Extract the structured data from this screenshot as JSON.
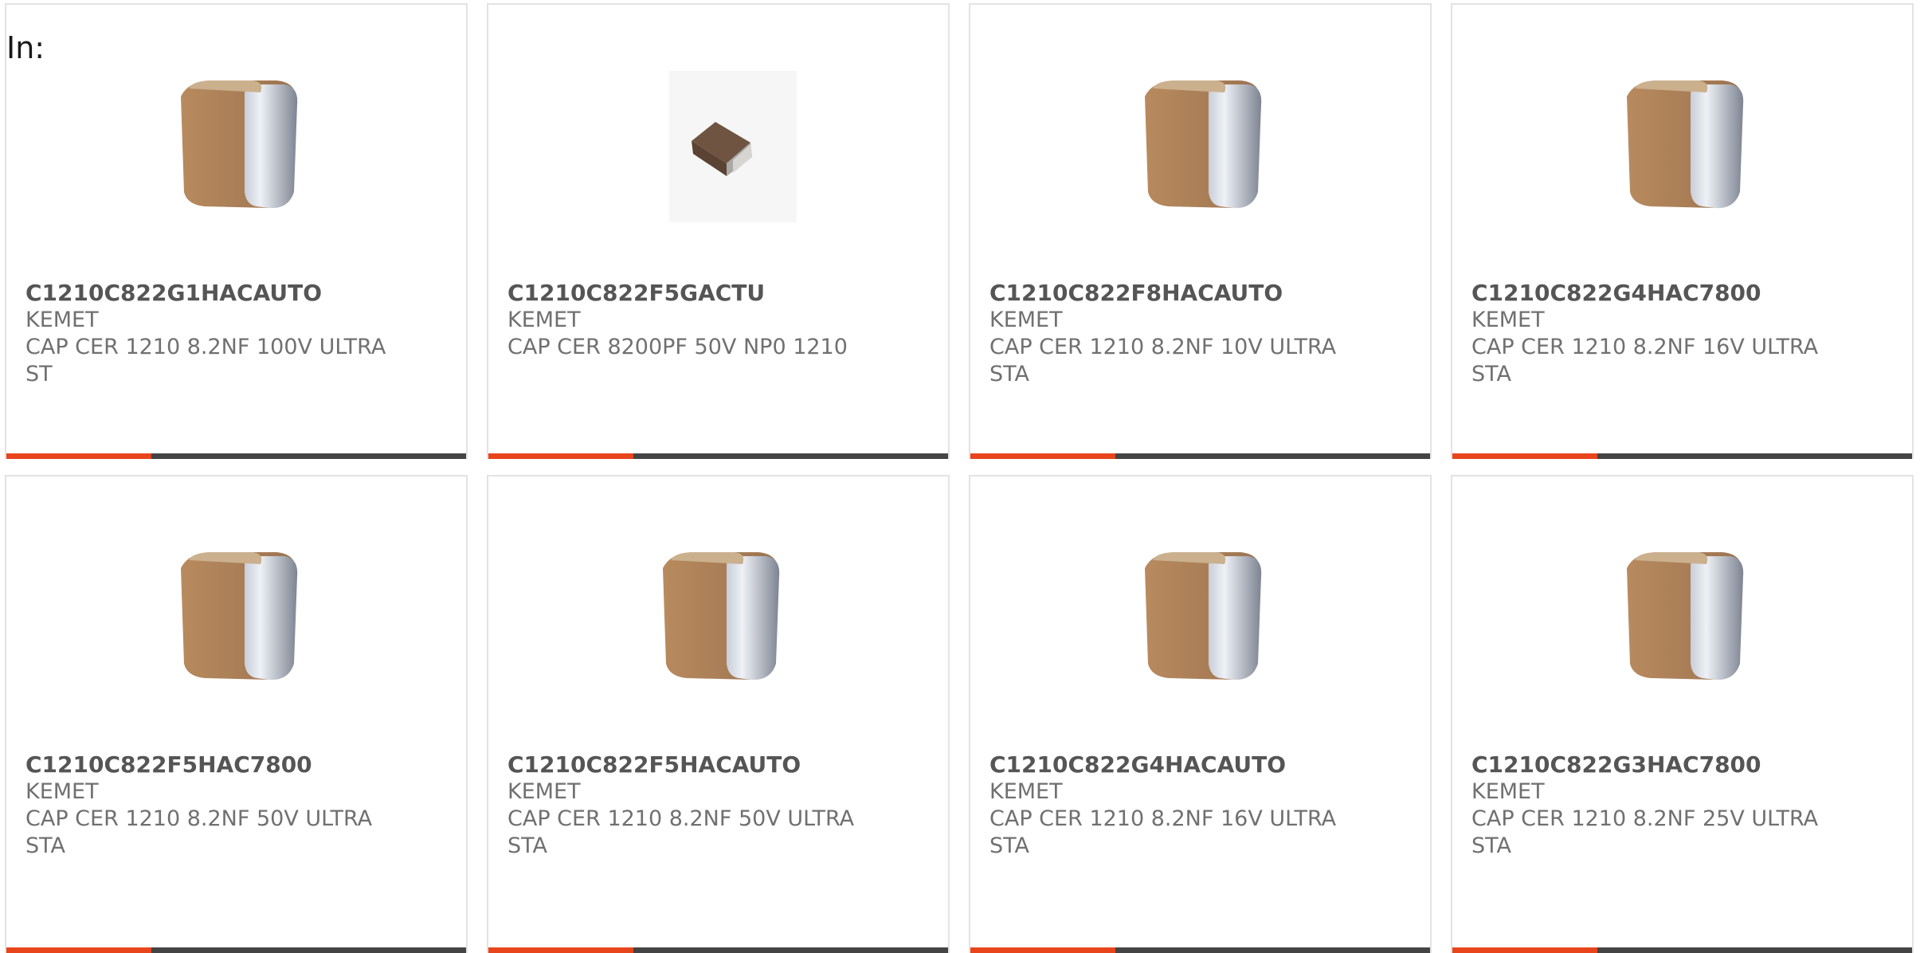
{
  "header": {
    "in_label": "In:"
  },
  "products": [
    {
      "part": "C1210C822G1HACAUTO",
      "maker": "KEMET",
      "desc": "CAP CER 1210 8.2NF 100V ULTRA ST",
      "image": "large-capacitor"
    },
    {
      "part": "C1210C822F5GACTU",
      "maker": "KEMET",
      "desc": "CAP CER 8200PF 50V NP0 1210",
      "image": "small-capacitor"
    },
    {
      "part": "C1210C822F8HACAUTO",
      "maker": "KEMET",
      "desc": "CAP CER 1210 8.2NF 10V ULTRA STA",
      "image": "large-capacitor"
    },
    {
      "part": "C1210C822G4HAC7800",
      "maker": "KEMET",
      "desc": "CAP CER 1210 8.2NF 16V ULTRA STA",
      "image": "large-capacitor"
    },
    {
      "part": "C1210C822F5HAC7800",
      "maker": "KEMET",
      "desc": "CAP CER 1210 8.2NF 50V ULTRA STA",
      "image": "large-capacitor"
    },
    {
      "part": "C1210C822F5HACAUTO",
      "maker": "KEMET",
      "desc": "CAP CER 1210 8.2NF 50V ULTRA STA",
      "image": "large-capacitor"
    },
    {
      "part": "C1210C822G4HACAUTO",
      "maker": "KEMET",
      "desc": "CAP CER 1210 8.2NF 16V ULTRA STA",
      "image": "large-capacitor"
    },
    {
      "part": "C1210C822G3HAC7800",
      "maker": "KEMET",
      "desc": "CAP CER 1210 8.2NF 25V ULTRA STA",
      "image": "large-capacitor"
    }
  ],
  "colors": {
    "accent": "#e8451c",
    "bar": "#444444",
    "border": "#e3e3e3",
    "text": "#707070"
  }
}
